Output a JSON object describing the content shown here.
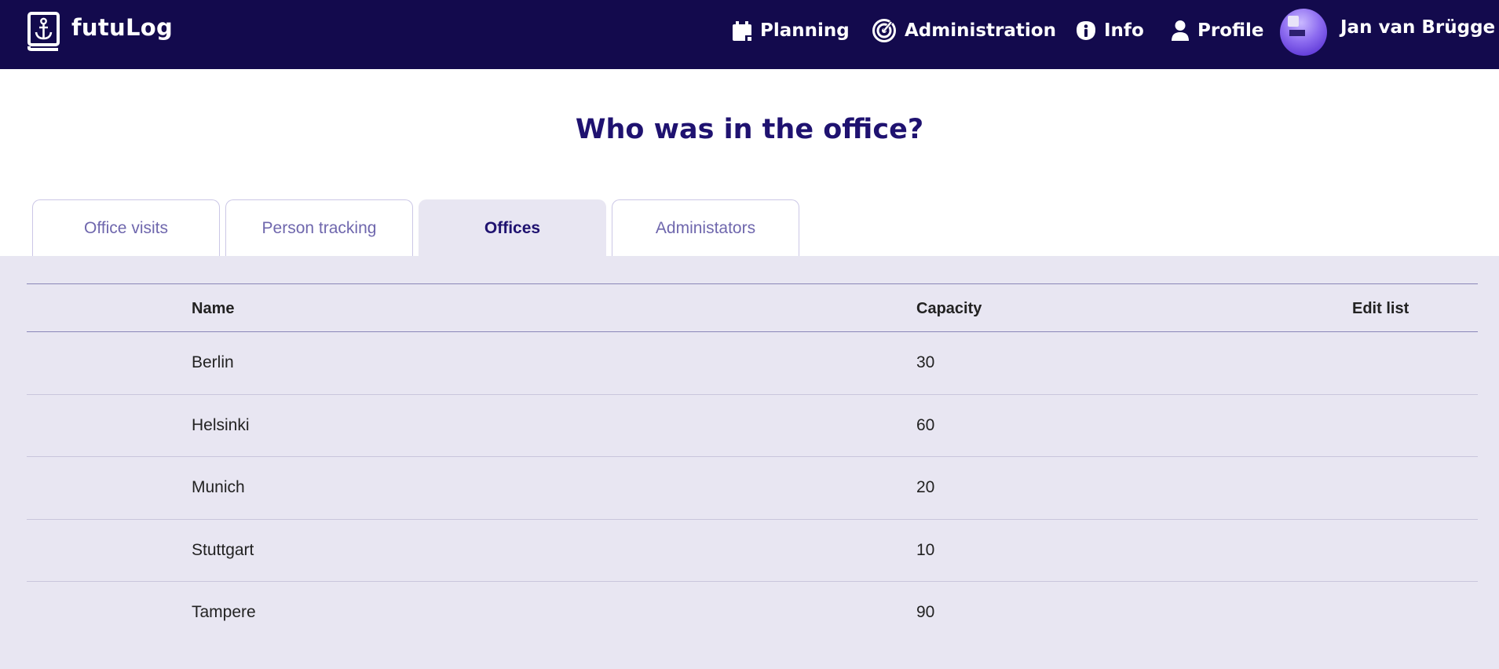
{
  "header": {
    "brand": "futuLog",
    "nav": {
      "planning": "Planning",
      "administration": "Administration",
      "info": "Info",
      "profile": "Profile"
    },
    "user_name": "Jan van Brügge"
  },
  "main": {
    "title": "Who was in the office?",
    "tabs": [
      {
        "label": "Office visits",
        "active": false
      },
      {
        "label": "Person tracking",
        "active": false
      },
      {
        "label": "Offices",
        "active": true
      },
      {
        "label": "Administators",
        "active": false
      }
    ],
    "table": {
      "columns": [
        "Name",
        "Capacity",
        "Edit list"
      ],
      "rows": [
        {
          "name": "Berlin",
          "capacity": "30"
        },
        {
          "name": "Helsinki",
          "capacity": "60"
        },
        {
          "name": "Munich",
          "capacity": "20"
        },
        {
          "name": "Stuttgart",
          "capacity": "10"
        },
        {
          "name": "Tampere",
          "capacity": "90"
        }
      ]
    }
  },
  "colors": {
    "navbar": "#130a4d",
    "title": "#1f1270",
    "panel": "#e8e6f2",
    "tab_text": "#6f67ad"
  },
  "icons": [
    "logbook-anchor-icon",
    "calendar-icon",
    "target-icon",
    "info-icon",
    "person-icon"
  ]
}
